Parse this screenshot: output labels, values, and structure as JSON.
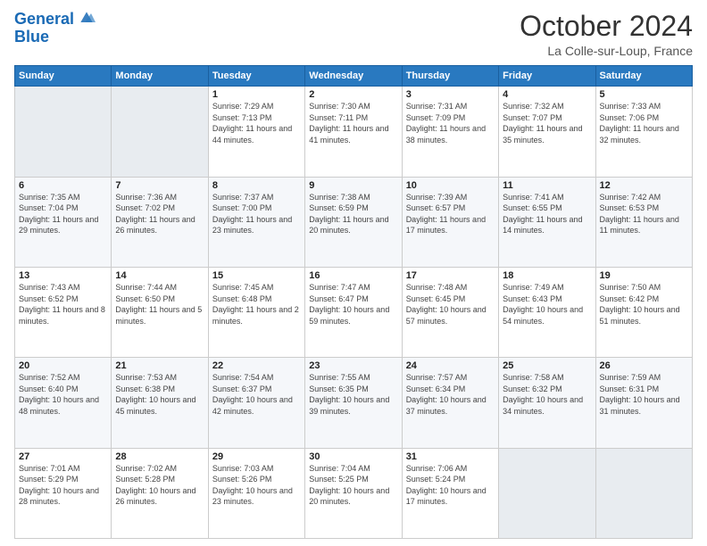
{
  "header": {
    "logo_line1": "General",
    "logo_line2": "Blue",
    "month_title": "October 2024",
    "location": "La Colle-sur-Loup, France"
  },
  "days_of_week": [
    "Sunday",
    "Monday",
    "Tuesday",
    "Wednesday",
    "Thursday",
    "Friday",
    "Saturday"
  ],
  "weeks": [
    [
      {
        "day": "",
        "info": ""
      },
      {
        "day": "",
        "info": ""
      },
      {
        "day": "1",
        "info": "Sunrise: 7:29 AM\nSunset: 7:13 PM\nDaylight: 11 hours and 44 minutes."
      },
      {
        "day": "2",
        "info": "Sunrise: 7:30 AM\nSunset: 7:11 PM\nDaylight: 11 hours and 41 minutes."
      },
      {
        "day": "3",
        "info": "Sunrise: 7:31 AM\nSunset: 7:09 PM\nDaylight: 11 hours and 38 minutes."
      },
      {
        "day": "4",
        "info": "Sunrise: 7:32 AM\nSunset: 7:07 PM\nDaylight: 11 hours and 35 minutes."
      },
      {
        "day": "5",
        "info": "Sunrise: 7:33 AM\nSunset: 7:06 PM\nDaylight: 11 hours and 32 minutes."
      }
    ],
    [
      {
        "day": "6",
        "info": "Sunrise: 7:35 AM\nSunset: 7:04 PM\nDaylight: 11 hours and 29 minutes."
      },
      {
        "day": "7",
        "info": "Sunrise: 7:36 AM\nSunset: 7:02 PM\nDaylight: 11 hours and 26 minutes."
      },
      {
        "day": "8",
        "info": "Sunrise: 7:37 AM\nSunset: 7:00 PM\nDaylight: 11 hours and 23 minutes."
      },
      {
        "day": "9",
        "info": "Sunrise: 7:38 AM\nSunset: 6:59 PM\nDaylight: 11 hours and 20 minutes."
      },
      {
        "day": "10",
        "info": "Sunrise: 7:39 AM\nSunset: 6:57 PM\nDaylight: 11 hours and 17 minutes."
      },
      {
        "day": "11",
        "info": "Sunrise: 7:41 AM\nSunset: 6:55 PM\nDaylight: 11 hours and 14 minutes."
      },
      {
        "day": "12",
        "info": "Sunrise: 7:42 AM\nSunset: 6:53 PM\nDaylight: 11 hours and 11 minutes."
      }
    ],
    [
      {
        "day": "13",
        "info": "Sunrise: 7:43 AM\nSunset: 6:52 PM\nDaylight: 11 hours and 8 minutes."
      },
      {
        "day": "14",
        "info": "Sunrise: 7:44 AM\nSunset: 6:50 PM\nDaylight: 11 hours and 5 minutes."
      },
      {
        "day": "15",
        "info": "Sunrise: 7:45 AM\nSunset: 6:48 PM\nDaylight: 11 hours and 2 minutes."
      },
      {
        "day": "16",
        "info": "Sunrise: 7:47 AM\nSunset: 6:47 PM\nDaylight: 10 hours and 59 minutes."
      },
      {
        "day": "17",
        "info": "Sunrise: 7:48 AM\nSunset: 6:45 PM\nDaylight: 10 hours and 57 minutes."
      },
      {
        "day": "18",
        "info": "Sunrise: 7:49 AM\nSunset: 6:43 PM\nDaylight: 10 hours and 54 minutes."
      },
      {
        "day": "19",
        "info": "Sunrise: 7:50 AM\nSunset: 6:42 PM\nDaylight: 10 hours and 51 minutes."
      }
    ],
    [
      {
        "day": "20",
        "info": "Sunrise: 7:52 AM\nSunset: 6:40 PM\nDaylight: 10 hours and 48 minutes."
      },
      {
        "day": "21",
        "info": "Sunrise: 7:53 AM\nSunset: 6:38 PM\nDaylight: 10 hours and 45 minutes."
      },
      {
        "day": "22",
        "info": "Sunrise: 7:54 AM\nSunset: 6:37 PM\nDaylight: 10 hours and 42 minutes."
      },
      {
        "day": "23",
        "info": "Sunrise: 7:55 AM\nSunset: 6:35 PM\nDaylight: 10 hours and 39 minutes."
      },
      {
        "day": "24",
        "info": "Sunrise: 7:57 AM\nSunset: 6:34 PM\nDaylight: 10 hours and 37 minutes."
      },
      {
        "day": "25",
        "info": "Sunrise: 7:58 AM\nSunset: 6:32 PM\nDaylight: 10 hours and 34 minutes."
      },
      {
        "day": "26",
        "info": "Sunrise: 7:59 AM\nSunset: 6:31 PM\nDaylight: 10 hours and 31 minutes."
      }
    ],
    [
      {
        "day": "27",
        "info": "Sunrise: 7:01 AM\nSunset: 5:29 PM\nDaylight: 10 hours and 28 minutes."
      },
      {
        "day": "28",
        "info": "Sunrise: 7:02 AM\nSunset: 5:28 PM\nDaylight: 10 hours and 26 minutes."
      },
      {
        "day": "29",
        "info": "Sunrise: 7:03 AM\nSunset: 5:26 PM\nDaylight: 10 hours and 23 minutes."
      },
      {
        "day": "30",
        "info": "Sunrise: 7:04 AM\nSunset: 5:25 PM\nDaylight: 10 hours and 20 minutes."
      },
      {
        "day": "31",
        "info": "Sunrise: 7:06 AM\nSunset: 5:24 PM\nDaylight: 10 hours and 17 minutes."
      },
      {
        "day": "",
        "info": ""
      },
      {
        "day": "",
        "info": ""
      }
    ]
  ]
}
